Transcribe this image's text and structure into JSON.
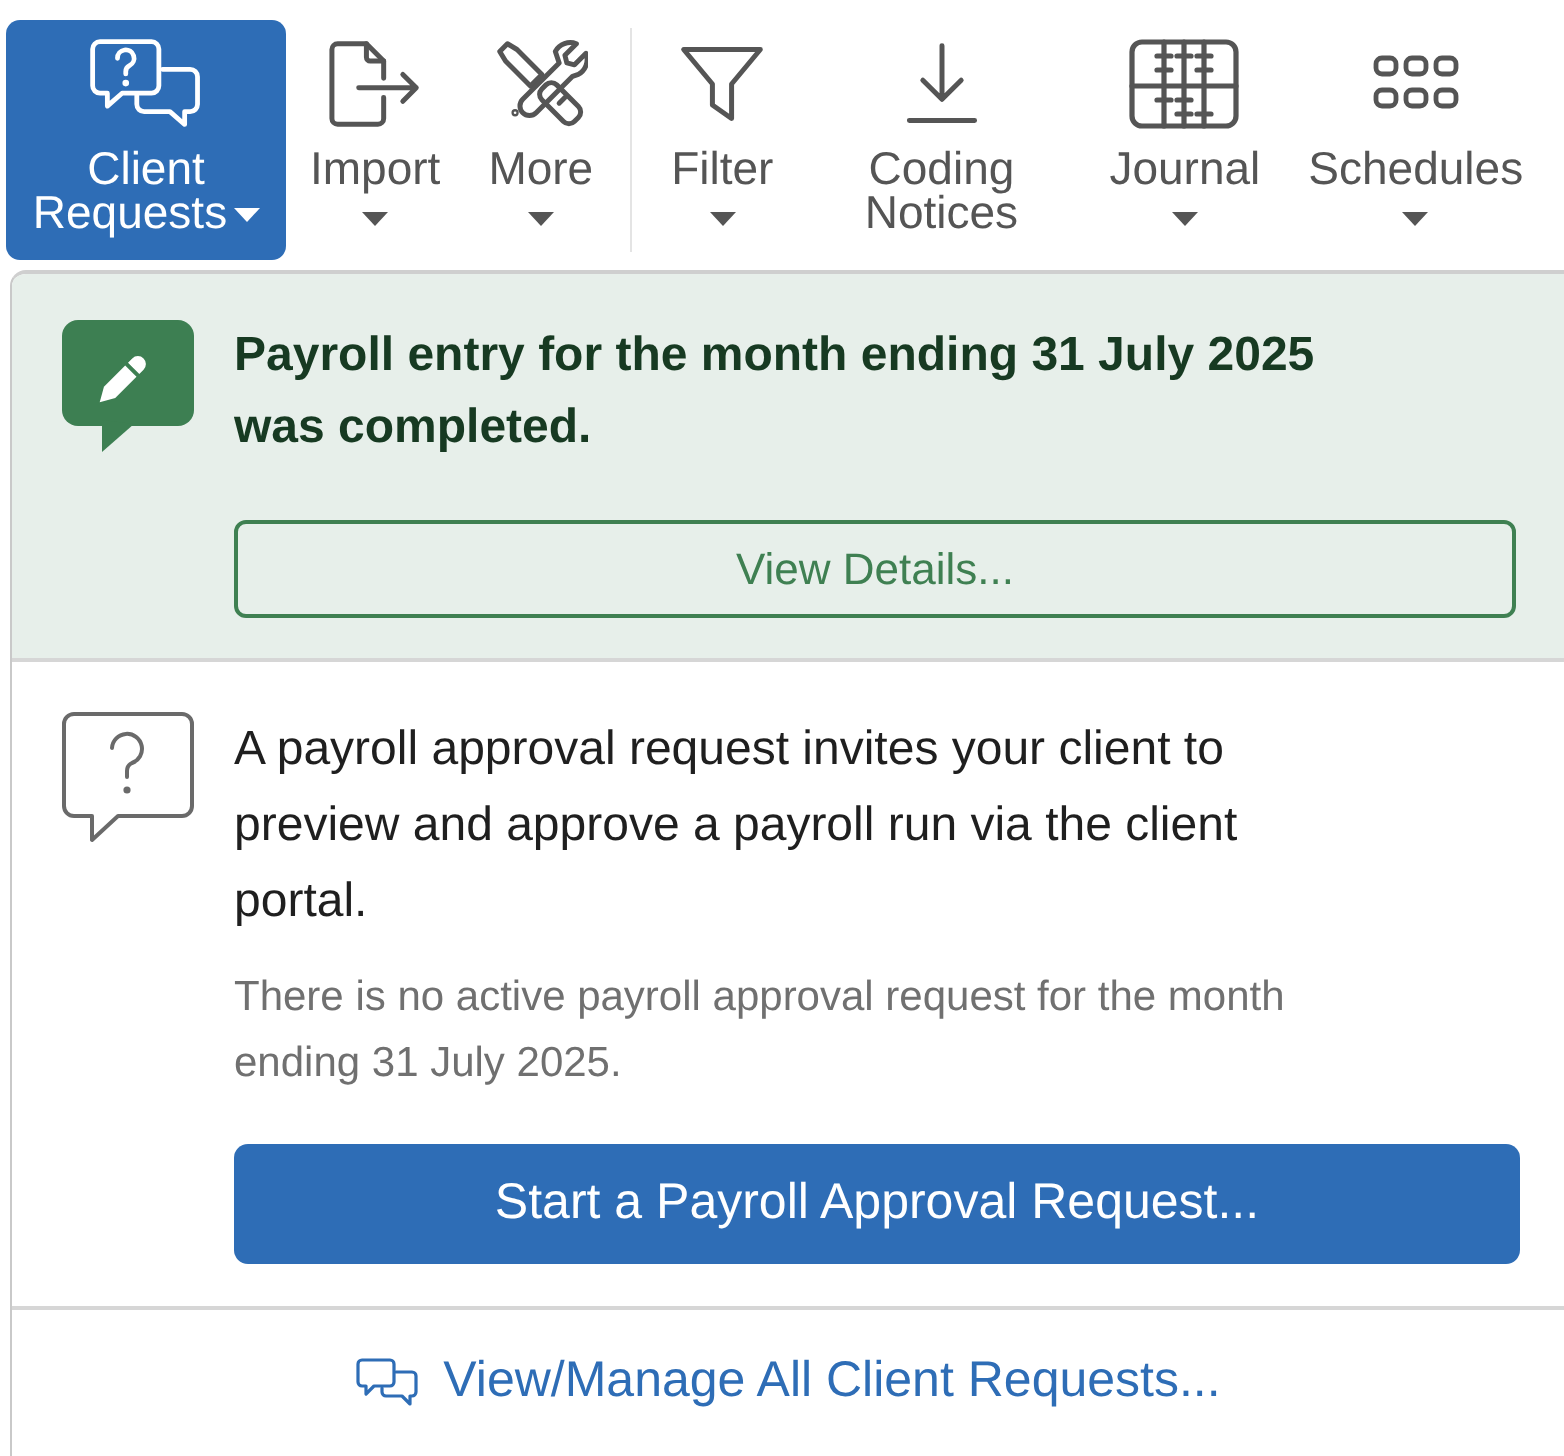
{
  "toolbar": {
    "groups": [
      {
        "buttons": [
          {
            "label": "Client Requests",
            "has_menu": true,
            "selected": true
          },
          {
            "label": "Import",
            "has_menu": true,
            "selected": false
          },
          {
            "label": "More",
            "has_menu": true,
            "selected": false
          }
        ]
      },
      {
        "buttons": [
          {
            "label": "Filter",
            "has_menu": true,
            "selected": false
          },
          {
            "label": "Coding Notices",
            "has_menu": false,
            "selected": false
          },
          {
            "label": "Journal",
            "has_menu": true,
            "selected": false
          },
          {
            "label": "Schedules",
            "has_menu": true,
            "selected": false
          }
        ]
      }
    ]
  },
  "dropdown": {
    "notice": {
      "title": "Payroll entry for the month ending 31 July 2025 was completed.",
      "button": "View Details..."
    },
    "info": {
      "text": "A payroll approval request invites your client to preview and approve a payroll run via the client portal.",
      "status": "There is no active payroll approval request for the month ending 31 July 2025.",
      "button": "Start a Payroll Approval Request..."
    },
    "footer_link": "View/Manage All Client Requests..."
  }
}
